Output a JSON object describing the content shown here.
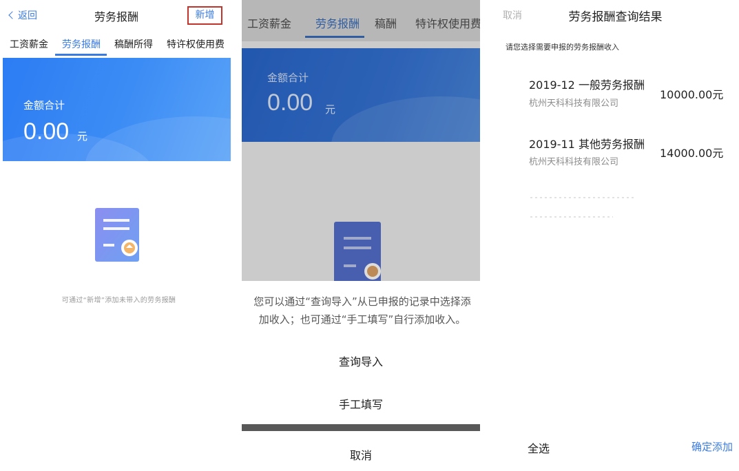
{
  "screen1": {
    "back_label": "返回",
    "title": "劳务报酬",
    "add_label": "新增",
    "tabs": [
      {
        "label": "工资薪金"
      },
      {
        "label": "劳务报酬"
      },
      {
        "label": "稿酬所得"
      },
      {
        "label": "特许权使用费"
      }
    ],
    "active_tab": "劳务报酬",
    "total_label": "金额合计",
    "total_amount": "0.00",
    "unit": "元",
    "empty_hint": "可通过“新增”添加未带入的劳务报酬"
  },
  "screen2": {
    "tabs": [
      {
        "label": "工资薪金"
      },
      {
        "label": "劳务报酬"
      },
      {
        "label": "稿酬"
      },
      {
        "label": "特许权使用费"
      }
    ],
    "active_tab": "劳务报酬",
    "total_label": "金额合计",
    "total_amount": "0.00",
    "unit": "元",
    "sheet_text": "您可以通过“查询导入”从已申报的记录中选择添加收入；也可通过“手工填写”自行添加收入。",
    "options": [
      {
        "label": "查询导入"
      },
      {
        "label": "手工填写"
      }
    ],
    "cancel_label": "取消"
  },
  "screen3": {
    "cancel_label": "取消",
    "title": "劳务报酬查询结果",
    "subtitle": "请您选择需要申报的劳务报酬收入",
    "items": [
      {
        "title": "2019-12 一般劳务报酬",
        "company": "杭州天科科技有限公司",
        "amount": "10000.00元"
      },
      {
        "title": "2019-11 其他劳务报酬",
        "company": "杭州天科科技有限公司",
        "amount": "14000.00元"
      }
    ],
    "select_all_label": "全选",
    "confirm_label": "确定添加"
  },
  "colors": {
    "accent": "#3a7be0",
    "highlight_border": "#c0342c",
    "banner_blue": "#2c7cf4"
  },
  "icons": [
    "chevron-left-icon",
    "document-illustration-icon"
  ]
}
